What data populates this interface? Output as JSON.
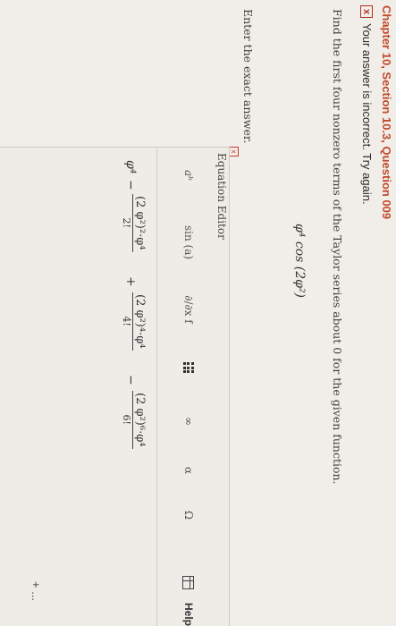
{
  "header": {
    "title": "Chapter 10, Section 10.3, Question 009"
  },
  "feedback": {
    "icon": "x-icon",
    "icon_glyph": "x",
    "message": "Your answer is incorrect.  Try again."
  },
  "question": {
    "prompt": "Find the first four nonzero terms of the Taylor series about 0 for the given function.",
    "function_display": "φ⁴ cos (2φ²)",
    "instruction": "Enter the exact answer."
  },
  "editor": {
    "title": "Equation Editor",
    "close_glyph": "x",
    "toolbar": {
      "power": "aᵇ",
      "sin": "sin (a)",
      "derivative": "∂/∂x f",
      "infinity": "∞",
      "alpha": "α",
      "omega": "Ω",
      "help": "Help"
    },
    "answer": {
      "term1": "φ⁴",
      "minus1": "−",
      "frac1_num": "(2 φ²)²·φ⁴",
      "frac1_den": "2!",
      "plus1": "+",
      "frac2_num": "(2 φ²)⁴·φ⁴",
      "frac2_den": "4!",
      "minus2": "−",
      "frac3_num": "(2 φ²)⁶·φ⁴",
      "frac3_den": "6!"
    },
    "trailing": "+ ..."
  }
}
